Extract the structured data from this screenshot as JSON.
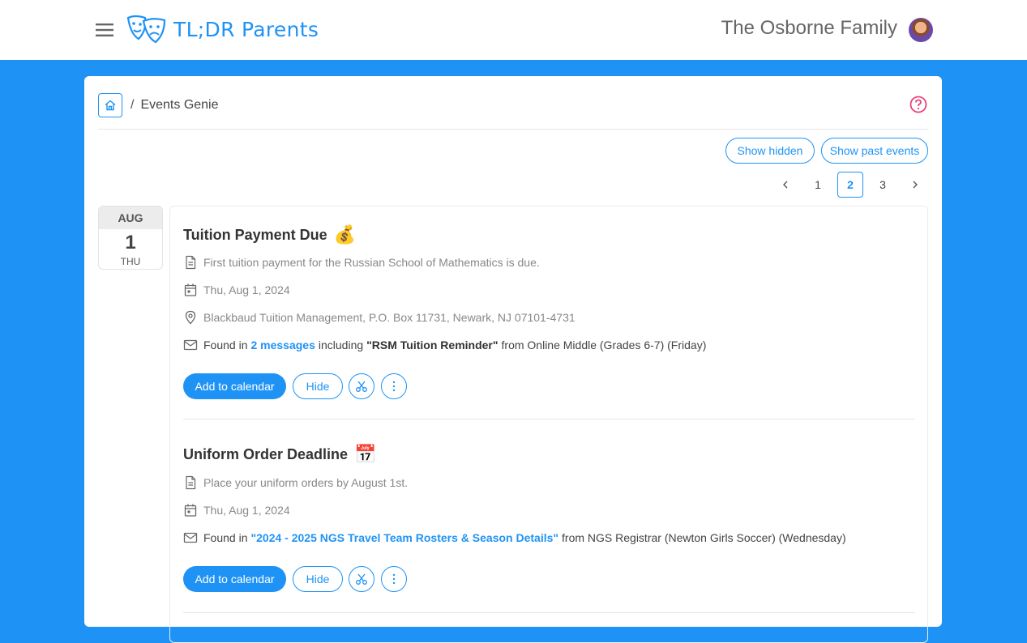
{
  "header": {
    "app_name": "TL;DR Parents",
    "family_name": "The Osborne Family"
  },
  "breadcrumb": {
    "current": "Events Genie",
    "separator": "/"
  },
  "actions": {
    "show_hidden": "Show hidden",
    "show_past": "Show past events"
  },
  "pagination": {
    "pages": [
      "1",
      "2",
      "3"
    ],
    "current": "2",
    "prev": "<",
    "next": ">"
  },
  "date": {
    "month": "AUG",
    "day": "1",
    "weekday": "THU"
  },
  "events": [
    {
      "title": "Tuition Payment Due",
      "emoji": "💰",
      "description": "First tuition payment for the Russian School of Mathematics is due.",
      "date": "Thu, Aug 1, 2024",
      "location": "Blackbaud Tuition Management, P.O. Box 11731, Newark, NJ 07101-4731",
      "found_prefix": "Found in",
      "found_link": "2 messages",
      "found_including": "including",
      "found_subject": "\"RSM Tuition Reminder\"",
      "found_from": "from Online Middle (Grades 6-7) (Friday)",
      "add_label": "Add to calendar",
      "hide_label": "Hide"
    },
    {
      "title": "Uniform Order Deadline",
      "emoji": "📅",
      "description": "Place your uniform orders by August 1st.",
      "date": "Thu, Aug 1, 2024",
      "found_prefix": "Found in",
      "found_link": "\"2024 - 2025 NGS Travel Team Rosters & Season Details\"",
      "found_from": "from NGS Registrar (Newton Girls Soccer) (Wednesday)",
      "add_label": "Add to calendar",
      "hide_label": "Hide"
    }
  ],
  "colors": {
    "accent": "#1f93f5",
    "help": "#e8437a"
  }
}
